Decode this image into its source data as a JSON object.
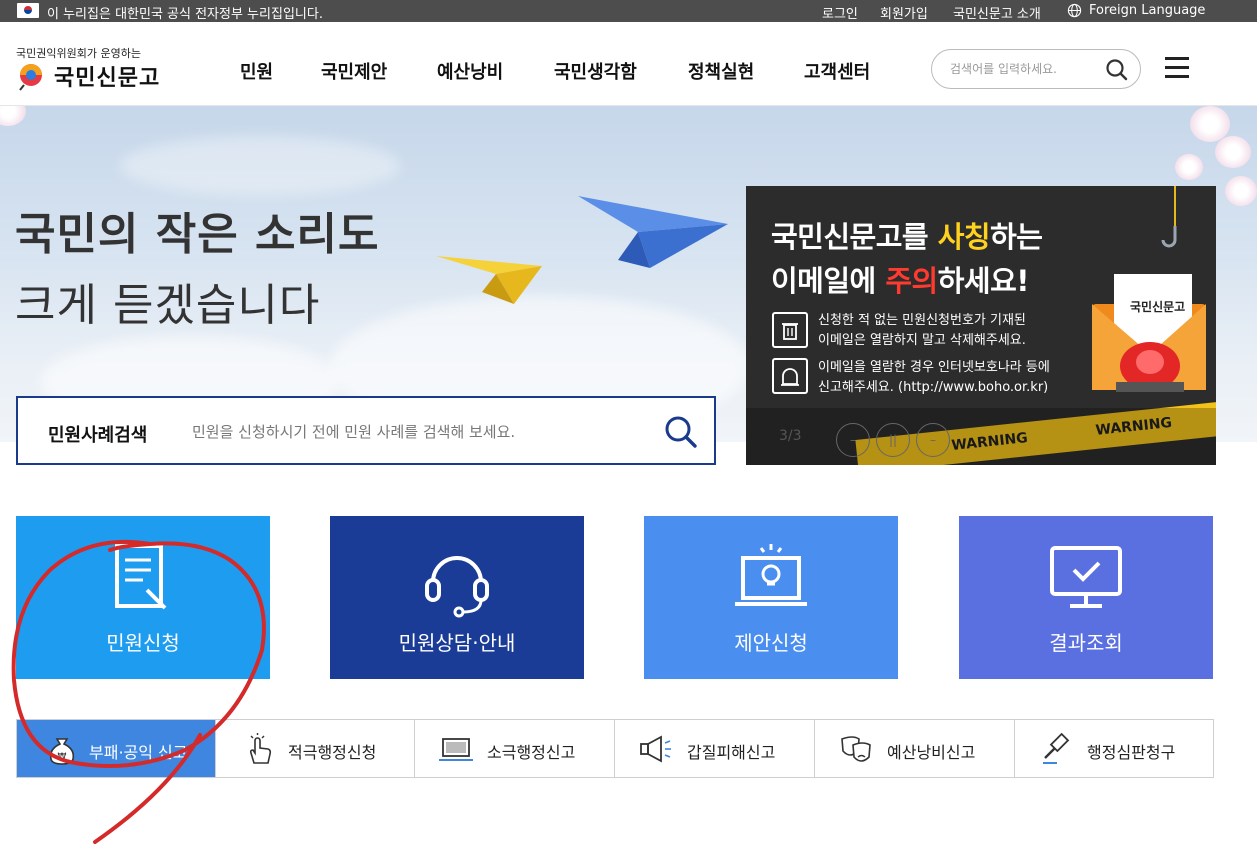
{
  "gov_banner": {
    "text": "이 누리집은 대한민국 공식 전자정부 누리집입니다.",
    "login": "로그인",
    "signup": "회원가입",
    "about": "국민신문고 소개",
    "foreign": "Foreign Language"
  },
  "header": {
    "logo_sub": "국민권익위원회가 운영하는",
    "logo_text": "국민신문고",
    "nav": [
      "민원",
      "국민제안",
      "예산낭비",
      "국민생각함",
      "정책실현",
      "고객센터"
    ],
    "search_placeholder": "검색어를 입력하세요."
  },
  "hero": {
    "title_line1": "국민의 작은 소리도",
    "title_line2": "크게 듣겠습니다",
    "case_search_label": "민원사례검색",
    "case_search_placeholder": "민원을 신청하시기 전에 민원 사례를 검색해 보세요."
  },
  "promo": {
    "line1_a": "국민신문고를 ",
    "line1_b": "사칭",
    "line1_c": "하는",
    "line2_a": "이메일에 ",
    "line2_b": "주의",
    "line2_c": "하세요!",
    "desc1_l1": "신청한 적 없는 민원신청번호가 기재된",
    "desc1_l2": "이메일은 열람하지 말고 삭제해주세요.",
    "desc2_l1": "이메일을 열람한 경우 인터넷보호나라 등에",
    "desc2_l2": "신고해주세요. (http://www.boho.or.kr)",
    "envelope_logo": "국민신문고",
    "warning": "WARNING",
    "page_indicator": "3/3",
    "prev": "–",
    "pause": "||",
    "next": "–",
    "colors": {
      "yellow": "#ffd21f",
      "red": "#ff3b2f"
    }
  },
  "tiles": [
    {
      "label": "민원신청",
      "icon": "document-pen-icon",
      "color": "#1e9cf0"
    },
    {
      "label": "민원상담·안내",
      "icon": "headset-icon",
      "color": "#1a3c96"
    },
    {
      "label": "제안신청",
      "icon": "laptop-lightbulb-icon",
      "color": "#4a8ff0"
    },
    {
      "label": "결과조회",
      "icon": "monitor-check-icon",
      "color": "#5a6fe0"
    }
  ],
  "report_tabs": [
    {
      "label": "부패·공익 신고",
      "icon": "money-bag-icon",
      "active": true
    },
    {
      "label": "적극행정신청",
      "icon": "touch-hand-icon",
      "active": false
    },
    {
      "label": "소극행정신고",
      "icon": "laptop-icon",
      "active": false
    },
    {
      "label": "갑질피해신고",
      "icon": "megaphone-icon",
      "active": false
    },
    {
      "label": "예산낭비신고",
      "icon": "masks-icon",
      "active": false
    },
    {
      "label": "행정심판청구",
      "icon": "gavel-icon",
      "active": false
    }
  ],
  "annotation": {
    "color": "#d42a2a"
  }
}
